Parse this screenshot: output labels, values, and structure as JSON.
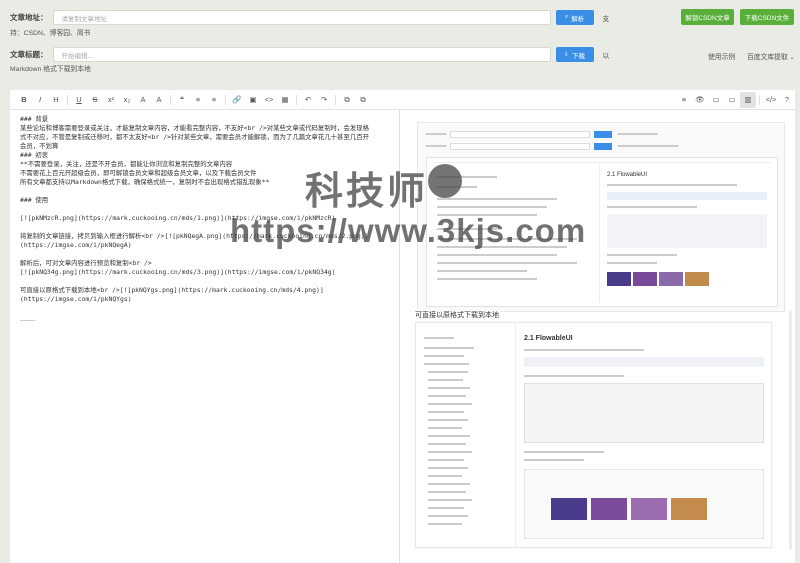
{
  "header": {
    "article_url_label": "文章地址：",
    "article_url_placeholder": "请复制文章地址",
    "parse_button": "解析",
    "supports_prefix": "支",
    "supports_text": "持：CSDN、博客园、简书",
    "unlock_csdn_button": "解锁CSDN文章",
    "download_csdn_button": "下载CSDN文件",
    "title_label": "文章标题：",
    "title_placeholder": "开始编辑...",
    "download_button": "下载",
    "download_suffix": "以",
    "download_desc": "Markdown 格式下载到本地",
    "usage_link": "使用示例",
    "baidu_link": "百度文库提取"
  },
  "toolbar": {
    "items": [
      "B",
      "I",
      "H",
      "U",
      "S",
      "x²",
      "x₂",
      "A",
      "A",
      "❝",
      "≡",
      "≡",
      "🔗",
      "▣",
      "<>",
      "▦",
      "↶",
      "↷",
      "⧉",
      "⧉"
    ],
    "right_items": [
      "≡",
      "👁",
      "▭",
      "▭",
      "▥",
      "</>",
      "?"
    ]
  },
  "editor": {
    "lines": [
      "### 背景",
      "某些论坛和博客需要登录或关注，才能复制文章内容，才能看完整内容，不友好<br />对某些文章或代码复制时，会发现格",
      "式不对应，不管是复制或迁移时，都不太友好<br />针对某些文章，需要会员才能解锁，而为了几篇文章花几十甚至几百开",
      "会员，不划算",
      "### 初衷",
      "**不需要登录，关注，还是不开会员，都能让你浏览和复制完整的文章内容",
      "不需要花上百元开超级会员，即可解锁会员文章和超级会员文章，以及下载会员文件",
      "所有文章都支持以Markdown格式下载，确保格式统一，复制时不会出现格式错乱现象**",
      "",
      "### 使用",
      "",
      "[![pkNMzcR.png](https://mark.cuckooing.cn/mds/1.png)](https://imgse.com/i/pkNMzcR)",
      "",
      "将复制的文章链接，拷贝到输入框进行解析<br />[![pkNQegA.png](https://mark.cuckooing.cn/mds/2.png)]",
      "(https://imgse.com/i/pkNQegA)",
      "",
      "解析后，可对文章内容进行预览和复制<br />",
      "[![pkNQ34g.png](https://mark.cuckooing.cn/mds/3.png)](https://imgse.com/i/pkNQ34g)",
      "",
      "可直接以原格式下载到本地<br />[![pkNQYgs.png](https://mark.cuckooing.cn/mds/4.png)]",
      "(https://imgse.com/i/pkNQYgs)",
      "",
      "____"
    ]
  },
  "preview": {
    "caption": "可直接以原格式下载到本地",
    "shot1_heading": "2.1 FlowableUI",
    "shot2_heading": "2.1 FlowableUI"
  },
  "watermark": {
    "line1": "科技师",
    "line2": "https://www.3kjs.com"
  }
}
